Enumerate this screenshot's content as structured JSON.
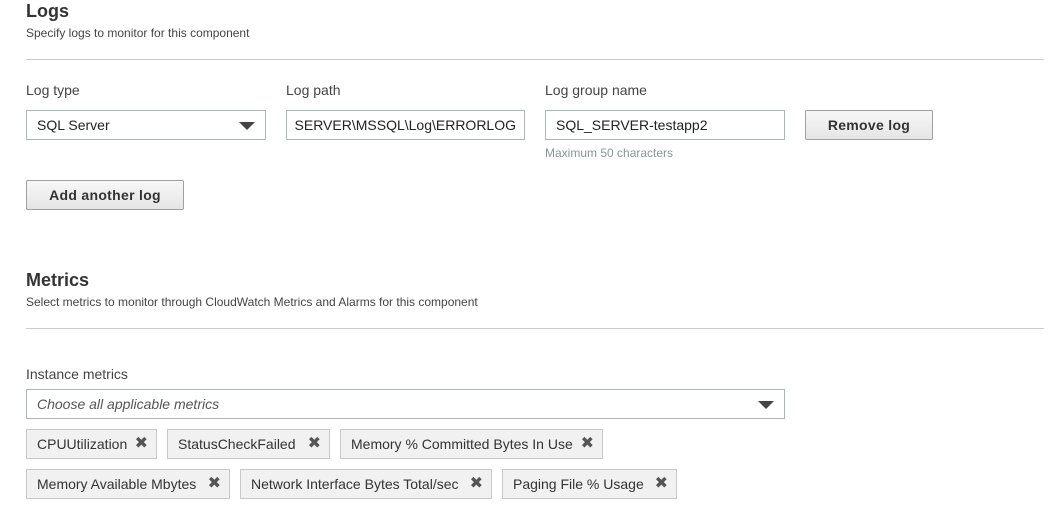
{
  "logs": {
    "title": "Logs",
    "description": "Specify logs to monitor for this component",
    "log_type_label": "Log type",
    "log_type_value": "SQL Server",
    "log_path_label": "Log path",
    "log_path_value": "SERVER\\MSSQL\\Log\\ERRORLOG",
    "log_group_label": "Log group name",
    "log_group_value": "SQL_SERVER-testapp2",
    "log_group_hint": "Maximum 50 characters",
    "remove_button": "Remove log",
    "add_button": "Add another log"
  },
  "metrics": {
    "title": "Metrics",
    "description": "Select metrics to monitor through CloudWatch Metrics and Alarms for this component",
    "instance_label": "Instance metrics",
    "instance_placeholder": "Choose all applicable metrics",
    "tokens": [
      "CPUUtilization",
      "StatusCheckFailed",
      "Memory % Committed Bytes In Use",
      "Memory Available Mbytes",
      "Network Interface Bytes Total/sec",
      "Paging File % Usage"
    ],
    "remove_glyph": "✖"
  }
}
